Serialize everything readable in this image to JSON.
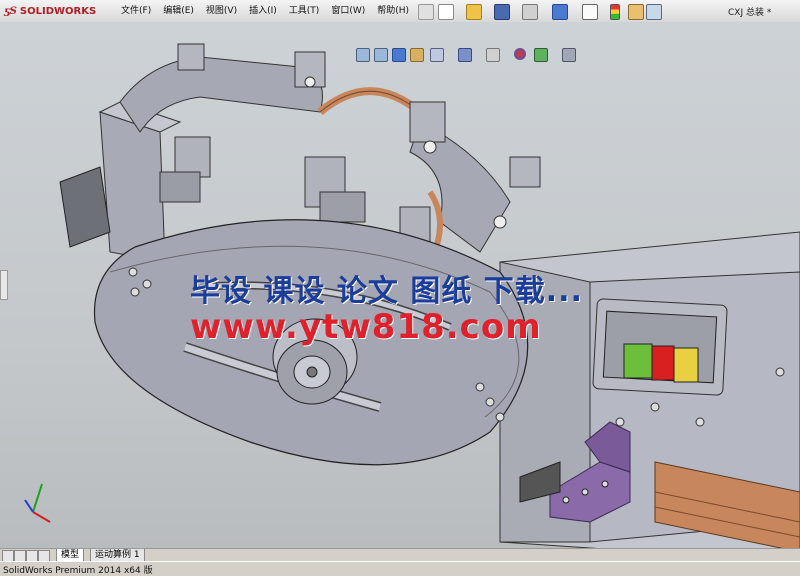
{
  "app": {
    "brand": "SOLIDWORKS",
    "document_title": "CXJ 总装 *"
  },
  "menu": {
    "items": [
      "文件(F)",
      "编辑(E)",
      "视图(V)",
      "插入(I)",
      "工具(T)",
      "窗口(W)",
      "帮助(H)"
    ]
  },
  "tabs": {
    "items": [
      "模型",
      "运动算例 1"
    ]
  },
  "status": {
    "text": "SolidWorks Premium 2014 x64 版"
  },
  "watermark": {
    "line1": "毕设 课设 论文 图纸 下载...",
    "line2": "www.ytw818.com"
  },
  "colors": {
    "brand_red": "#b01e23",
    "watermark_blue": "#1a3c9a",
    "watermark_red": "#e0202a",
    "button_green": "#6bbf3a",
    "button_red": "#d82020",
    "button_yellow": "#e8d040",
    "bracket_purple": "#8a6aa8",
    "rail_copper": "#c8865c"
  }
}
